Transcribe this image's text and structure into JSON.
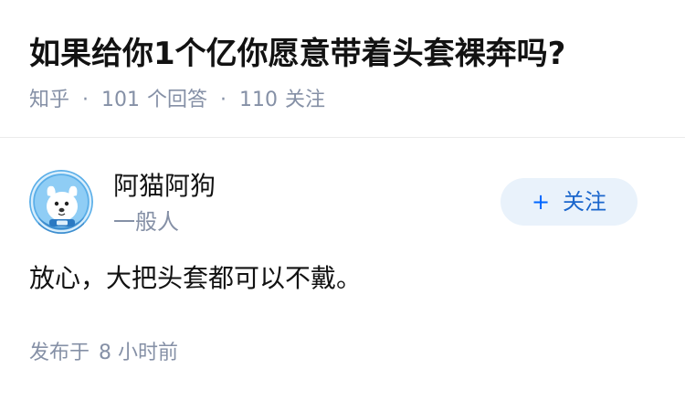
{
  "question": {
    "title": "如果给你1个亿你愿意带着头套裸奔吗?",
    "source": "知乎",
    "answers_count": "101",
    "answers_label": "个回答",
    "followers_count": "110",
    "followers_label": "关注"
  },
  "answer": {
    "author": {
      "name": "阿猫阿狗",
      "bio": "一般人",
      "avatar_icon": "dog-astronaut-avatar"
    },
    "follow_button": {
      "icon": "plus-icon",
      "plus": "+",
      "label": "关注"
    },
    "content": "放心，大把头套都可以不戴。",
    "published_label": "发布于",
    "published_time": "8 小时前"
  },
  "colors": {
    "title": "#121212",
    "meta": "#8590a6",
    "accent": "#0066ff",
    "follow_bg": "#e9f2fb",
    "avatar_bg": "#5aaee8",
    "divider": "#ebebeb"
  }
}
